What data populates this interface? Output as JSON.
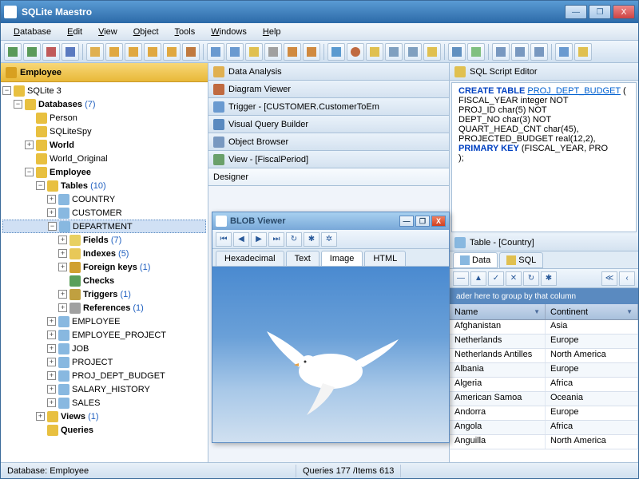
{
  "app": {
    "title": "SQLite Maestro"
  },
  "menu": {
    "items": [
      "Database",
      "Edit",
      "View",
      "Object",
      "Tools",
      "Windows",
      "Help"
    ]
  },
  "sidebar": {
    "title": "Employee",
    "root": "SQLite 3",
    "databases_label": "Databases",
    "databases_count": "(7)",
    "db_items": [
      "Person",
      "SQLiteSpy",
      "World",
      "World_Original",
      "Employee"
    ],
    "tables_label": "Tables",
    "tables_count": "(10)",
    "tables": [
      "COUNTRY",
      "CUSTOMER",
      "DEPARTMENT",
      "EMPLOYEE",
      "EMPLOYEE_PROJECT",
      "JOB",
      "PROJECT",
      "PROJ_DEPT_BUDGET",
      "SALARY_HISTORY",
      "SALES"
    ],
    "dept": {
      "fields_label": "Fields",
      "fields_count": "(7)",
      "indexes_label": "Indexes",
      "indexes_count": "(5)",
      "fk_label": "Foreign keys",
      "fk_count": "(1)",
      "checks_label": "Checks",
      "triggers_label": "Triggers",
      "triggers_count": "(1)",
      "refs_label": "References",
      "refs_count": "(1)"
    },
    "views_label": "Views",
    "views_count": "(1)",
    "queries_label": "Queries"
  },
  "panels": {
    "data_analysis": "Data Analysis",
    "diagram": "Diagram Viewer",
    "trigger": "Trigger - [CUSTOMER.CustomerToEm",
    "vqb": "Visual Query Builder",
    "object_browser": "Object Browser",
    "view": "View - [FiscalPeriod]",
    "designer": "Designer"
  },
  "sql_editor": {
    "title": "SQL Script Editor",
    "code": {
      "l1a": "CREATE TABLE ",
      "l1b": "PROJ_DEPT_BUDGET",
      "l1c": " (",
      "l2": "  FISCAL_YEAR      integer NOT",
      "l3": "  PROJ_ID          char(5) NOT",
      "l4": "  DEPT_NO          char(3) NOT",
      "l5": "  QUART_HEAD_CNT   char(45),",
      "l6": "  PROJECTED_BUDGET real(12,2),",
      "l7": "  PRIMARY KEY (FISCAL_YEAR, PRO",
      "l8": ");"
    }
  },
  "table_panel": {
    "title": "Table - [Country]",
    "tabs": {
      "data": "Data",
      "sql": "SQL"
    },
    "group_hint": "ader here to group by that column",
    "cols": {
      "name": "Name",
      "continent": "Continent"
    },
    "rows": [
      {
        "name": "Afghanistan",
        "continent": "Asia"
      },
      {
        "name": "Netherlands",
        "continent": "Europe"
      },
      {
        "name": "Netherlands Antilles",
        "continent": "North America"
      },
      {
        "name": "Albania",
        "continent": "Europe"
      },
      {
        "name": "Algeria",
        "continent": "Africa"
      },
      {
        "name": "American Samoa",
        "continent": "Oceania"
      },
      {
        "name": "Andorra",
        "continent": "Europe"
      },
      {
        "name": "Angola",
        "continent": "Africa"
      },
      {
        "name": "Anguilla",
        "continent": "North America"
      }
    ]
  },
  "blob": {
    "title": "BLOB Viewer",
    "tabs": {
      "hex": "Hexadecimal",
      "text": "Text",
      "image": "Image",
      "html": "HTML"
    }
  },
  "status": {
    "db": "Database: Employee",
    "queries": "Queries 177 /Items 613"
  }
}
